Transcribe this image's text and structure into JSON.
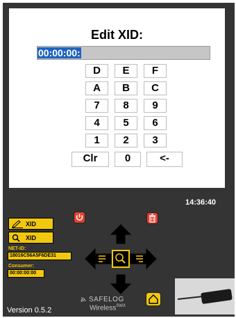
{
  "editor": {
    "title": "Edit XID:",
    "input_value_selected": "00:00:00:",
    "keys_left": [
      "D",
      "A",
      "7",
      "4",
      "1",
      "Clr"
    ],
    "keys_mid": [
      "E",
      "B",
      "8",
      "5",
      "2",
      "0"
    ],
    "keys_right": [
      "F",
      "C",
      "9",
      "6",
      "3",
      "<-"
    ]
  },
  "status": {
    "time": "14:36:40"
  },
  "controls": {
    "edit_xid_label": "XID",
    "search_xid_label": "XID",
    "net_id_label": "NET-ID:",
    "net_id_value": "18016C56A5F6DE31",
    "consumer_label": "Consumer:",
    "consumer_value": "00:00:00:00"
  },
  "footer": {
    "version": "Version 0.5.2",
    "brand_name": "SAFELOG",
    "brand_sub": "Wireless",
    "brand_sup": "SWX"
  },
  "colors": {
    "accent_yellow": "#f2c80e",
    "danger_red": "#e8402f",
    "panel_dark": "#343434",
    "selection_blue": "#1f63c0"
  },
  "icons": [
    "pencil-icon",
    "magnifier-icon",
    "power-icon",
    "trash-icon",
    "arrow-up-icon",
    "arrow-down-icon",
    "arrow-left-icon",
    "arrow-right-icon",
    "home-icon",
    "wifi-logo-icon"
  ]
}
